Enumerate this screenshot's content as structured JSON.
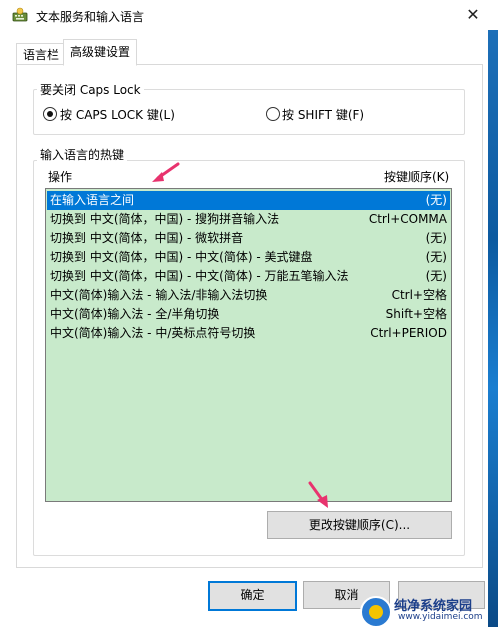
{
  "window": {
    "title": "文本服务和输入语言",
    "close_glyph": "✕"
  },
  "tabs": [
    {
      "label": "语言栏",
      "active": false
    },
    {
      "label": "高级键设置",
      "active": true
    }
  ],
  "caps_lock_group": {
    "legend": "要关闭 Caps Lock",
    "options": [
      {
        "label": "按 CAPS LOCK 键(L)",
        "selected": true
      },
      {
        "label": "按 SHIFT 键(F)",
        "selected": false
      }
    ]
  },
  "hotkeys_group": {
    "legend": "输入语言的热键",
    "col_action": "操作",
    "col_sequence": "按键顺序(K)",
    "rows": [
      {
        "action": "在输入语言之间",
        "keys": "(无)",
        "selected": true
      },
      {
        "action": "切换到 中文(简体，中国) - 搜狗拼音输入法",
        "keys": "Ctrl+COMMA",
        "selected": false
      },
      {
        "action": "切换到 中文(简体，中国) - 微软拼音",
        "keys": "(无)",
        "selected": false
      },
      {
        "action": "切换到 中文(简体，中国) - 中文(简体) - 美式键盘",
        "keys": "(无)",
        "selected": false
      },
      {
        "action": "切换到 中文(简体，中国) - 中文(简体) - 万能五笔输入法",
        "keys": "(无)",
        "selected": false
      },
      {
        "action": "中文(简体)输入法 - 输入法/非输入法切换",
        "keys": "Ctrl+空格",
        "selected": false
      },
      {
        "action": "中文(简体)输入法 - 全/半角切换",
        "keys": "Shift+空格",
        "selected": false
      },
      {
        "action": "中文(简体)输入法 - 中/英标点符号切换",
        "keys": "Ctrl+PERIOD",
        "selected": false
      }
    ],
    "change_button": "更改按键顺序(C)..."
  },
  "footer": {
    "ok": "确定",
    "cancel": "取消",
    "apply": ""
  },
  "watermark": {
    "name": "纯净系统家园",
    "url": "www.yidaimei.com"
  },
  "colors": {
    "selection": "#0078d7",
    "list_bg": "#c8eacb",
    "arrow": "#e8336e"
  }
}
